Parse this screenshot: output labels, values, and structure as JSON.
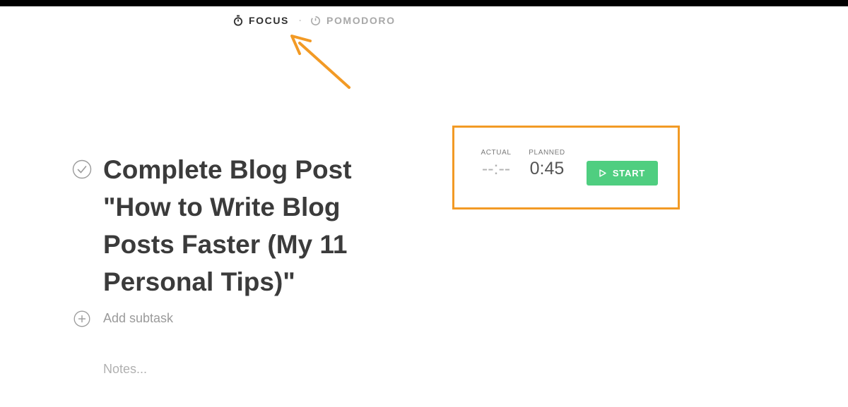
{
  "mode_switch": {
    "focus_label": "FOCUS",
    "separator": "·",
    "pomodoro_label": "POMODORO",
    "active": "FOCUS"
  },
  "task": {
    "title": "Complete Blog Post \"How to Write Blog Posts Faster (My 11 Personal Tips)\"",
    "completed": false
  },
  "subtask": {
    "placeholder": "Add subtask"
  },
  "notes": {
    "placeholder": "Notes..."
  },
  "timer": {
    "actual_label": "ACTUAL",
    "actual_value": "--:--",
    "planned_label": "PLANNED",
    "planned_value": "0:45",
    "start_label": "START"
  },
  "colors": {
    "start_button": "#4fce80",
    "annotation": "#f29a25"
  },
  "icons": {
    "focus": "stopwatch-icon",
    "pomodoro": "timer-icon",
    "task_check": "check-circle-icon",
    "add_subtask": "plus-circle-icon",
    "start": "play-icon"
  }
}
